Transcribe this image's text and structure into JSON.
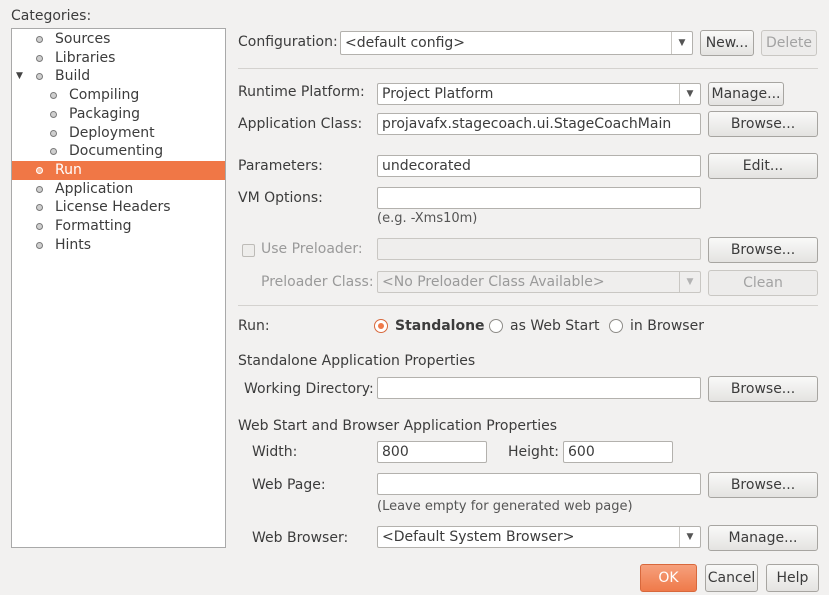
{
  "categories": {
    "label": "Categories:",
    "items": [
      {
        "label": "Sources",
        "level": 0,
        "expander": ""
      },
      {
        "label": "Libraries",
        "level": 0,
        "expander": ""
      },
      {
        "label": "Build",
        "level": 0,
        "expander": "▼"
      },
      {
        "label": "Compiling",
        "level": 1,
        "expander": ""
      },
      {
        "label": "Packaging",
        "level": 1,
        "expander": ""
      },
      {
        "label": "Deployment",
        "level": 1,
        "expander": ""
      },
      {
        "label": "Documenting",
        "level": 1,
        "expander": ""
      },
      {
        "label": "Run",
        "level": 0,
        "expander": "",
        "selected": true
      },
      {
        "label": "Application",
        "level": 0,
        "expander": ""
      },
      {
        "label": "License Headers",
        "level": 0,
        "expander": ""
      },
      {
        "label": "Formatting",
        "level": 0,
        "expander": ""
      },
      {
        "label": "Hints",
        "level": 0,
        "expander": ""
      }
    ]
  },
  "configuration": {
    "label": "Configuration:",
    "value": "<default config>",
    "new_label": "New...",
    "delete_label": "Delete"
  },
  "runtime_platform": {
    "label": "Runtime Platform:",
    "value": "Project Platform",
    "manage_label": "Manage..."
  },
  "application_class": {
    "label": "Application Class:",
    "value": "projavafx.stagecoach.ui.StageCoachMain",
    "browse_label": "Browse..."
  },
  "parameters": {
    "label": "Parameters:",
    "value": "undecorated",
    "edit_label": "Edit..."
  },
  "vm_options": {
    "label": "VM Options:",
    "value": "",
    "hint": "(e.g. -Xms10m)"
  },
  "preloader": {
    "use_label": "Use Preloader:",
    "value": "",
    "browse_label": "Browse...",
    "class_label": "Preloader Class:",
    "class_value": "<No Preloader Class Available>",
    "clean_label": "Clean"
  },
  "run": {
    "label": "Run:",
    "options": [
      "Standalone",
      "as Web Start",
      "in Browser"
    ],
    "selected": "Standalone"
  },
  "standalone": {
    "heading": "Standalone Application Properties",
    "working_dir_label": "Working Directory:",
    "working_dir_value": "",
    "browse_label": "Browse..."
  },
  "web": {
    "heading": "Web Start and Browser Application Properties",
    "width_label": "Width:",
    "width_value": "800",
    "height_label": "Height:",
    "height_value": "600",
    "page_label": "Web Page:",
    "page_value": "",
    "page_browse_label": "Browse...",
    "page_hint": "(Leave empty for generated web page)",
    "browser_label": "Web Browser:",
    "browser_value": "<Default System Browser>",
    "browser_manage_label": "Manage..."
  },
  "footer": {
    "ok_label": "OK",
    "cancel_label": "Cancel",
    "help_label": "Help"
  },
  "colors": {
    "accent": "#ef7a4a",
    "selection": "#f07746",
    "background": "#f2f1f0"
  }
}
